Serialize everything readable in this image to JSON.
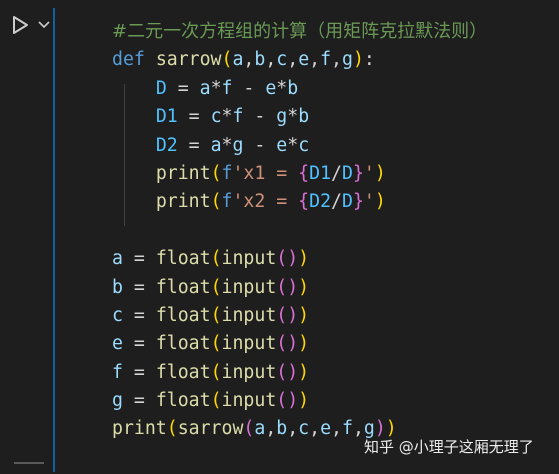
{
  "cell": {
    "run_icon": "run-cell-triangle-icon",
    "menu_icon": "chevron-down-icon",
    "accent_color": "#0e639c",
    "lines": [
      {
        "kind": "comment",
        "text": "#二元一次方程组的计算（用矩阵克拉默法则）"
      },
      {
        "kind": "code",
        "tokens": [
          {
            "t": "def",
            "c": "kw"
          },
          {
            "t": " ",
            "c": "op"
          },
          {
            "t": "sarrow",
            "c": "fn"
          },
          {
            "t": "(",
            "c": "br1"
          },
          {
            "t": "a",
            "c": "var"
          },
          {
            "t": ",",
            "c": "op"
          },
          {
            "t": "b",
            "c": "var"
          },
          {
            "t": ",",
            "c": "op"
          },
          {
            "t": "c",
            "c": "var"
          },
          {
            "t": ",",
            "c": "op"
          },
          {
            "t": "e",
            "c": "var"
          },
          {
            "t": ",",
            "c": "op"
          },
          {
            "t": "f",
            "c": "var"
          },
          {
            "t": ",",
            "c": "op"
          },
          {
            "t": "g",
            "c": "var"
          },
          {
            "t": ")",
            "c": "br1"
          },
          {
            "t": ":",
            "c": "op"
          }
        ]
      },
      {
        "kind": "code",
        "tokens": [
          {
            "t": "    ",
            "c": "op"
          },
          {
            "t": "D",
            "c": "const"
          },
          {
            "t": " = ",
            "c": "op"
          },
          {
            "t": "a",
            "c": "var"
          },
          {
            "t": "*",
            "c": "op"
          },
          {
            "t": "f",
            "c": "var"
          },
          {
            "t": " - ",
            "c": "op"
          },
          {
            "t": "e",
            "c": "var"
          },
          {
            "t": "*",
            "c": "op"
          },
          {
            "t": "b",
            "c": "var"
          }
        ]
      },
      {
        "kind": "code",
        "tokens": [
          {
            "t": "    ",
            "c": "op"
          },
          {
            "t": "D1",
            "c": "const"
          },
          {
            "t": " = ",
            "c": "op"
          },
          {
            "t": "c",
            "c": "var"
          },
          {
            "t": "*",
            "c": "op"
          },
          {
            "t": "f",
            "c": "var"
          },
          {
            "t": " - ",
            "c": "op"
          },
          {
            "t": "g",
            "c": "var"
          },
          {
            "t": "*",
            "c": "op"
          },
          {
            "t": "b",
            "c": "var"
          }
        ]
      },
      {
        "kind": "code",
        "tokens": [
          {
            "t": "    ",
            "c": "op"
          },
          {
            "t": "D2",
            "c": "const"
          },
          {
            "t": " = ",
            "c": "op"
          },
          {
            "t": "a",
            "c": "var"
          },
          {
            "t": "*",
            "c": "op"
          },
          {
            "t": "g",
            "c": "var"
          },
          {
            "t": " - ",
            "c": "op"
          },
          {
            "t": "e",
            "c": "var"
          },
          {
            "t": "*",
            "c": "op"
          },
          {
            "t": "c",
            "c": "var"
          }
        ]
      },
      {
        "kind": "code",
        "tokens": [
          {
            "t": "    ",
            "c": "op"
          },
          {
            "t": "print",
            "c": "fn"
          },
          {
            "t": "(",
            "c": "br1"
          },
          {
            "t": "f",
            "c": "kw"
          },
          {
            "t": "'x1 = ",
            "c": "str"
          },
          {
            "t": "{",
            "c": "br2"
          },
          {
            "t": "D1",
            "c": "const"
          },
          {
            "t": "/",
            "c": "op"
          },
          {
            "t": "D",
            "c": "const"
          },
          {
            "t": "}",
            "c": "br2"
          },
          {
            "t": "'",
            "c": "str"
          },
          {
            "t": ")",
            "c": "br1"
          }
        ]
      },
      {
        "kind": "code",
        "tokens": [
          {
            "t": "    ",
            "c": "op"
          },
          {
            "t": "print",
            "c": "fn"
          },
          {
            "t": "(",
            "c": "br1"
          },
          {
            "t": "f",
            "c": "kw"
          },
          {
            "t": "'x2 = ",
            "c": "str"
          },
          {
            "t": "{",
            "c": "br2"
          },
          {
            "t": "D2",
            "c": "const"
          },
          {
            "t": "/",
            "c": "op"
          },
          {
            "t": "D",
            "c": "const"
          },
          {
            "t": "}",
            "c": "br2"
          },
          {
            "t": "'",
            "c": "str"
          },
          {
            "t": ")",
            "c": "br1"
          }
        ]
      },
      {
        "kind": "blank"
      },
      {
        "kind": "code",
        "tokens": [
          {
            "t": "a",
            "c": "var"
          },
          {
            "t": " = ",
            "c": "op"
          },
          {
            "t": "float",
            "c": "fn"
          },
          {
            "t": "(",
            "c": "br1"
          },
          {
            "t": "input",
            "c": "fn"
          },
          {
            "t": "(",
            "c": "br2"
          },
          {
            "t": ")",
            "c": "br2"
          },
          {
            "t": ")",
            "c": "br1"
          }
        ]
      },
      {
        "kind": "code",
        "tokens": [
          {
            "t": "b",
            "c": "var"
          },
          {
            "t": " = ",
            "c": "op"
          },
          {
            "t": "float",
            "c": "fn"
          },
          {
            "t": "(",
            "c": "br1"
          },
          {
            "t": "input",
            "c": "fn"
          },
          {
            "t": "(",
            "c": "br2"
          },
          {
            "t": ")",
            "c": "br2"
          },
          {
            "t": ")",
            "c": "br1"
          }
        ]
      },
      {
        "kind": "code",
        "tokens": [
          {
            "t": "c",
            "c": "var"
          },
          {
            "t": " = ",
            "c": "op"
          },
          {
            "t": "float",
            "c": "fn"
          },
          {
            "t": "(",
            "c": "br1"
          },
          {
            "t": "input",
            "c": "fn"
          },
          {
            "t": "(",
            "c": "br2"
          },
          {
            "t": ")",
            "c": "br2"
          },
          {
            "t": ")",
            "c": "br1"
          }
        ]
      },
      {
        "kind": "code",
        "tokens": [
          {
            "t": "e",
            "c": "var"
          },
          {
            "t": " = ",
            "c": "op"
          },
          {
            "t": "float",
            "c": "fn"
          },
          {
            "t": "(",
            "c": "br1"
          },
          {
            "t": "input",
            "c": "fn"
          },
          {
            "t": "(",
            "c": "br2"
          },
          {
            "t": ")",
            "c": "br2"
          },
          {
            "t": ")",
            "c": "br1"
          }
        ]
      },
      {
        "kind": "code",
        "tokens": [
          {
            "t": "f",
            "c": "var"
          },
          {
            "t": " = ",
            "c": "op"
          },
          {
            "t": "float",
            "c": "fn"
          },
          {
            "t": "(",
            "c": "br1"
          },
          {
            "t": "input",
            "c": "fn"
          },
          {
            "t": "(",
            "c": "br2"
          },
          {
            "t": ")",
            "c": "br2"
          },
          {
            "t": ")",
            "c": "br1"
          }
        ]
      },
      {
        "kind": "code",
        "tokens": [
          {
            "t": "g",
            "c": "var"
          },
          {
            "t": " = ",
            "c": "op"
          },
          {
            "t": "float",
            "c": "fn"
          },
          {
            "t": "(",
            "c": "br1"
          },
          {
            "t": "input",
            "c": "fn"
          },
          {
            "t": "(",
            "c": "br2"
          },
          {
            "t": ")",
            "c": "br2"
          },
          {
            "t": ")",
            "c": "br1"
          }
        ]
      },
      {
        "kind": "code",
        "tokens": [
          {
            "t": "print",
            "c": "fn"
          },
          {
            "t": "(",
            "c": "br1"
          },
          {
            "t": "sarrow",
            "c": "fn"
          },
          {
            "t": "(",
            "c": "br2"
          },
          {
            "t": "a",
            "c": "var"
          },
          {
            "t": ",",
            "c": "op"
          },
          {
            "t": "b",
            "c": "var"
          },
          {
            "t": ",",
            "c": "op"
          },
          {
            "t": "c",
            "c": "var"
          },
          {
            "t": ",",
            "c": "op"
          },
          {
            "t": "e",
            "c": "var"
          },
          {
            "t": ",",
            "c": "op"
          },
          {
            "t": "f",
            "c": "var"
          },
          {
            "t": ",",
            "c": "op"
          },
          {
            "t": "g",
            "c": "var"
          },
          {
            "t": ")",
            "c": "br2"
          },
          {
            "t": ")",
            "c": "br1"
          }
        ]
      }
    ]
  },
  "watermark": {
    "text": "知乎 @小理子这厢无理了"
  }
}
